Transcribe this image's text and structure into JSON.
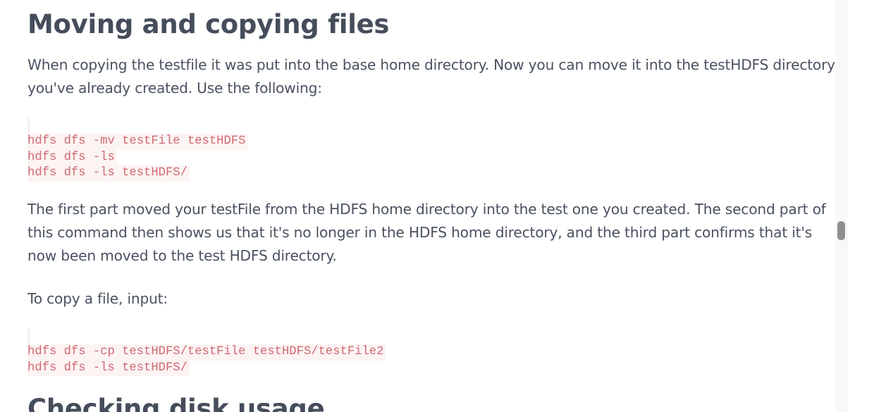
{
  "article": {
    "heading_moving": "Moving and copying files",
    "para_intro": "When copying the testfile it was put into the base home directory. Now you can move it into the testHDFS directory you've already created. Use the following:",
    "code_move": [
      "hdfs dfs -mv testFile testHDFS",
      "hdfs dfs -ls",
      "hdfs dfs -ls testHDFS/"
    ],
    "para_explain": "The first part moved your testFile from the HDFS home directory into the test one you created. The second part of this command then shows us that it's no longer in the HDFS home directory, and the third part confirms that it's now been moved to the test HDFS directory.",
    "para_copy": "To copy a file, input:",
    "code_copy": [
      "hdfs dfs -cp testHDFS/testFile testHDFS/testFile2",
      "hdfs dfs -ls testHDFS/"
    ],
    "heading_disk": "Checking disk usage"
  },
  "colors": {
    "text": "#4a5260",
    "heading": "#454d5b",
    "code_text": "#cf6a72",
    "code_bg": "#fcf3f3",
    "scroll_thumb": "#8f8f8f"
  }
}
